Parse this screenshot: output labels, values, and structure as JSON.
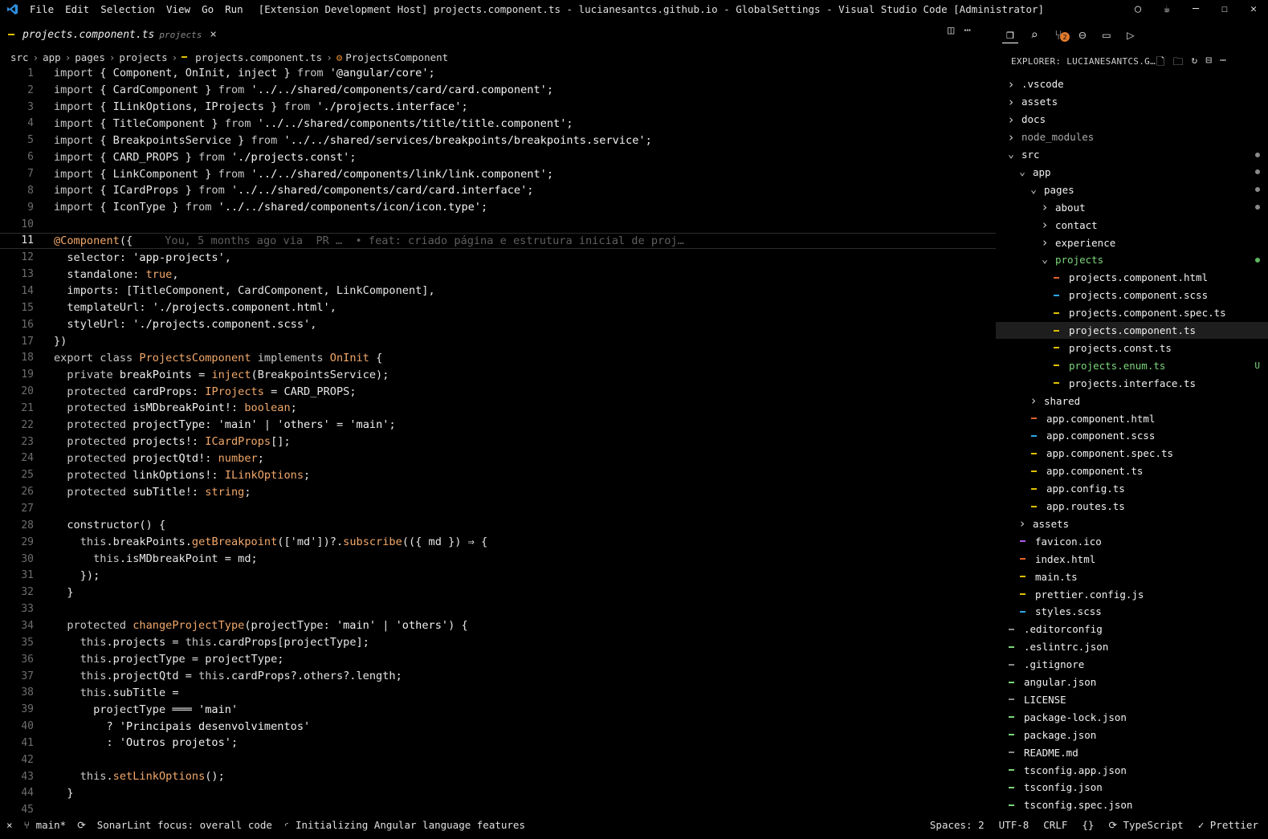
{
  "window": {
    "menu": [
      "File",
      "Edit",
      "Selection",
      "View",
      "Go",
      "Run"
    ],
    "title": "[Extension Development Host] projects.component.ts - lucianesantcs.github.io - GlobalSettings - Visual Studio Code [Administrator]"
  },
  "tab": {
    "name": "projects.component.ts",
    "dir": "projects",
    "close": "×"
  },
  "breadcrumb": {
    "items": [
      "src",
      "app",
      "pages",
      "projects"
    ],
    "file": "projects.component.ts",
    "symbol": "ProjectsComponent"
  },
  "editor": {
    "current_line": 11,
    "blame": "You, 5 months ago via  PR …  • feat: criado página e estrutura inicial de proj…",
    "lines": [
      {
        "n": "1",
        "t": [
          [
            "k",
            "import "
          ],
          [
            "p",
            "{ Component, OnInit, inject } "
          ],
          [
            "k",
            "from "
          ],
          [
            "s",
            "'@angular/core'"
          ],
          [
            "p",
            ";"
          ]
        ]
      },
      {
        "n": "2",
        "t": [
          [
            "k",
            "import "
          ],
          [
            "p",
            "{ CardComponent } "
          ],
          [
            "k",
            "from "
          ],
          [
            "s",
            "'../../shared/components/card/card.component'"
          ],
          [
            "p",
            ";"
          ]
        ]
      },
      {
        "n": "3",
        "t": [
          [
            "k",
            "import "
          ],
          [
            "p",
            "{ ILinkOptions, IProjects } "
          ],
          [
            "k",
            "from "
          ],
          [
            "s",
            "'./projects.interface'"
          ],
          [
            "p",
            ";"
          ]
        ]
      },
      {
        "n": "4",
        "t": [
          [
            "k",
            "import "
          ],
          [
            "p",
            "{ TitleComponent } "
          ],
          [
            "k",
            "from "
          ],
          [
            "s",
            "'../../shared/components/title/title.component'"
          ],
          [
            "p",
            ";"
          ]
        ]
      },
      {
        "n": "5",
        "t": [
          [
            "k",
            "import "
          ],
          [
            "p",
            "{ BreakpointsService } "
          ],
          [
            "k",
            "from "
          ],
          [
            "s",
            "'../../shared/services/breakpoints/breakpoints.service'"
          ],
          [
            "p",
            ";"
          ]
        ]
      },
      {
        "n": "6",
        "t": [
          [
            "k",
            "import "
          ],
          [
            "p",
            "{ CARD_PROPS } "
          ],
          [
            "k",
            "from "
          ],
          [
            "s",
            "'./projects.const'"
          ],
          [
            "p",
            ";"
          ]
        ]
      },
      {
        "n": "7",
        "t": [
          [
            "k",
            "import "
          ],
          [
            "p",
            "{ LinkComponent } "
          ],
          [
            "k",
            "from "
          ],
          [
            "s",
            "'../../shared/components/link/link.component'"
          ],
          [
            "p",
            ";"
          ]
        ]
      },
      {
        "n": "8",
        "t": [
          [
            "k",
            "import "
          ],
          [
            "p",
            "{ ICardProps } "
          ],
          [
            "k",
            "from "
          ],
          [
            "s",
            "'../../shared/components/card/card.interface'"
          ],
          [
            "p",
            ";"
          ]
        ]
      },
      {
        "n": "9",
        "t": [
          [
            "k",
            "import "
          ],
          [
            "p",
            "{ IconType } "
          ],
          [
            "k",
            "from "
          ],
          [
            "s",
            "'../../shared/components/icon/icon.type'"
          ],
          [
            "p",
            ";"
          ]
        ]
      },
      {
        "n": "10",
        "t": []
      },
      {
        "n": "11",
        "t": [
          [
            "d",
            "@Component"
          ],
          [
            "p",
            "({"
          ]
        ]
      },
      {
        "n": "12",
        "t": [
          [
            "p",
            "  selector: "
          ],
          [
            "s",
            "'app-projects'"
          ],
          [
            "p",
            ","
          ]
        ]
      },
      {
        "n": "13",
        "t": [
          [
            "p",
            "  standalone: "
          ],
          [
            "b",
            "true"
          ],
          [
            "p",
            ","
          ]
        ]
      },
      {
        "n": "14",
        "t": [
          [
            "p",
            "  imports: [TitleComponent, CardComponent, LinkComponent],"
          ]
        ]
      },
      {
        "n": "15",
        "t": [
          [
            "p",
            "  templateUrl: "
          ],
          [
            "s",
            "'./projects.component.html'"
          ],
          [
            "p",
            ","
          ]
        ]
      },
      {
        "n": "16",
        "t": [
          [
            "p",
            "  styleUrl: "
          ],
          [
            "s",
            "'./projects.component.scss'"
          ],
          [
            "p",
            ","
          ]
        ]
      },
      {
        "n": "17",
        "t": [
          [
            "p",
            "})"
          ]
        ]
      },
      {
        "n": "18",
        "t": [
          [
            "k",
            "export class "
          ],
          [
            "t",
            "ProjectsComponent "
          ],
          [
            "k",
            "implements "
          ],
          [
            "t",
            "OnInit "
          ],
          [
            "p",
            "{"
          ]
        ]
      },
      {
        "n": "19",
        "t": [
          [
            "k",
            "  private "
          ],
          [
            "v",
            "breakPoints "
          ],
          [
            "p",
            "= "
          ],
          [
            "f",
            "inject"
          ],
          [
            "p",
            "(BreakpointsService);"
          ]
        ]
      },
      {
        "n": "20",
        "t": [
          [
            "k",
            "  protected "
          ],
          [
            "v",
            "cardProps"
          ],
          [
            "p",
            ": "
          ],
          [
            "t",
            "IProjects "
          ],
          [
            "p",
            "= CARD_PROPS;"
          ]
        ]
      },
      {
        "n": "21",
        "t": [
          [
            "k",
            "  protected "
          ],
          [
            "v",
            "isMDbreakPoint"
          ],
          [
            "p",
            "!: "
          ],
          [
            "t",
            "boolean"
          ],
          [
            "p",
            ";"
          ]
        ]
      },
      {
        "n": "22",
        "t": [
          [
            "k",
            "  protected "
          ],
          [
            "v",
            "projectType"
          ],
          [
            "p",
            ": "
          ],
          [
            "s",
            "'main'"
          ],
          [
            "p",
            " | "
          ],
          [
            "s",
            "'others'"
          ],
          [
            "p",
            " = "
          ],
          [
            "s",
            "'main'"
          ],
          [
            "p",
            ";"
          ]
        ]
      },
      {
        "n": "23",
        "t": [
          [
            "k",
            "  protected "
          ],
          [
            "v",
            "projects"
          ],
          [
            "p",
            "!: "
          ],
          [
            "t",
            "ICardProps"
          ],
          [
            "p",
            "[];"
          ]
        ]
      },
      {
        "n": "24",
        "t": [
          [
            "k",
            "  protected "
          ],
          [
            "v",
            "projectQtd"
          ],
          [
            "p",
            "!: "
          ],
          [
            "t",
            "number"
          ],
          [
            "p",
            ";"
          ]
        ]
      },
      {
        "n": "25",
        "t": [
          [
            "k",
            "  protected "
          ],
          [
            "v",
            "linkOptions"
          ],
          [
            "p",
            "!: "
          ],
          [
            "t",
            "ILinkOptions"
          ],
          [
            "p",
            ";"
          ]
        ]
      },
      {
        "n": "26",
        "t": [
          [
            "k",
            "  protected "
          ],
          [
            "v",
            "subTitle"
          ],
          [
            "p",
            "!: "
          ],
          [
            "t",
            "string"
          ],
          [
            "p",
            ";"
          ]
        ]
      },
      {
        "n": "27",
        "t": []
      },
      {
        "n": "28",
        "t": [
          [
            "p",
            "  constructor() {"
          ]
        ]
      },
      {
        "n": "29",
        "t": [
          [
            "k",
            "    this"
          ],
          [
            "p",
            ".breakPoints."
          ],
          [
            "f",
            "getBreakpoint"
          ],
          [
            "p",
            "(['md'])?."
          ],
          [
            "f",
            "subscribe"
          ],
          [
            "p",
            "(({ md }) ⇒ {"
          ]
        ]
      },
      {
        "n": "30",
        "t": [
          [
            "k",
            "      this"
          ],
          [
            "p",
            ".isMDbreakPoint = md;"
          ]
        ]
      },
      {
        "n": "31",
        "t": [
          [
            "p",
            "    });"
          ]
        ]
      },
      {
        "n": "32",
        "t": [
          [
            "p",
            "  }"
          ]
        ]
      },
      {
        "n": "33",
        "t": []
      },
      {
        "n": "34",
        "t": [
          [
            "k",
            "  protected "
          ],
          [
            "f",
            "changeProjectType"
          ],
          [
            "p",
            "(projectType: "
          ],
          [
            "s",
            "'main'"
          ],
          [
            "p",
            " | "
          ],
          [
            "s",
            "'others'"
          ],
          [
            "p",
            ") {"
          ]
        ]
      },
      {
        "n": "35",
        "t": [
          [
            "k",
            "    this"
          ],
          [
            "p",
            ".projects = "
          ],
          [
            "k",
            "this"
          ],
          [
            "p",
            ".cardProps[projectType];"
          ]
        ]
      },
      {
        "n": "36",
        "t": [
          [
            "k",
            "    this"
          ],
          [
            "p",
            ".projectType = projectType;"
          ]
        ]
      },
      {
        "n": "37",
        "t": [
          [
            "k",
            "    this"
          ],
          [
            "p",
            ".projectQtd = "
          ],
          [
            "k",
            "this"
          ],
          [
            "p",
            ".cardProps?.others?.length;"
          ]
        ]
      },
      {
        "n": "38",
        "t": [
          [
            "k",
            "    this"
          ],
          [
            "p",
            ".subTitle ="
          ]
        ]
      },
      {
        "n": "39",
        "t": [
          [
            "p",
            "      projectType ═══ "
          ],
          [
            "s",
            "'main'"
          ]
        ]
      },
      {
        "n": "40",
        "t": [
          [
            "p",
            "        ? "
          ],
          [
            "s",
            "'Principais desenvolvimentos'"
          ]
        ]
      },
      {
        "n": "41",
        "t": [
          [
            "p",
            "        : "
          ],
          [
            "s",
            "'Outros projetos'"
          ],
          [
            "p",
            ";"
          ]
        ]
      },
      {
        "n": "42",
        "t": []
      },
      {
        "n": "43",
        "t": [
          [
            "k",
            "    this"
          ],
          [
            "p",
            "."
          ],
          [
            "f",
            "setLinkOptions"
          ],
          [
            "p",
            "();"
          ]
        ]
      },
      {
        "n": "44",
        "t": [
          [
            "p",
            "  }"
          ]
        ]
      },
      {
        "n": "45",
        "t": []
      }
    ]
  },
  "explorer": {
    "header": "EXPLORER: LUCIANESANTCS.G…",
    "items": [
      {
        "label": ".vscode",
        "depth": 0,
        "kind": "folder"
      },
      {
        "label": "assets",
        "depth": 0,
        "kind": "folder"
      },
      {
        "label": "docs",
        "depth": 0,
        "kind": "folder"
      },
      {
        "label": "node_modules",
        "depth": 0,
        "kind": "folder",
        "dim": true
      },
      {
        "label": "src",
        "depth": 0,
        "kind": "folder-open",
        "dot": "grey"
      },
      {
        "label": "app",
        "depth": 1,
        "kind": "folder-open",
        "dot": "grey"
      },
      {
        "label": "pages",
        "depth": 2,
        "kind": "folder-open",
        "dot": "grey"
      },
      {
        "label": "about",
        "depth": 3,
        "kind": "folder",
        "dot": "grey"
      },
      {
        "label": "contact",
        "depth": 3,
        "kind": "folder"
      },
      {
        "label": "experience",
        "depth": 3,
        "kind": "folder"
      },
      {
        "label": "projects",
        "depth": 3,
        "kind": "folder-open",
        "dot": "green",
        "green": true
      },
      {
        "label": "projects.component.html",
        "depth": 4,
        "kind": "file",
        "color": "#e8622c"
      },
      {
        "label": "projects.component.scss",
        "depth": 4,
        "kind": "file",
        "color": "#2ca8e8"
      },
      {
        "label": "projects.component.spec.ts",
        "depth": 4,
        "kind": "file",
        "color": "#e0c000"
      },
      {
        "label": "projects.component.ts",
        "depth": 4,
        "kind": "file",
        "color": "#e0c000",
        "selected": true
      },
      {
        "label": "projects.const.ts",
        "depth": 4,
        "kind": "file",
        "color": "#e0c000"
      },
      {
        "label": "projects.enum.ts",
        "depth": 4,
        "kind": "file",
        "color": "#e0c000",
        "green": true,
        "u": "U"
      },
      {
        "label": "projects.interface.ts",
        "depth": 4,
        "kind": "file",
        "color": "#e0c000"
      },
      {
        "label": "shared",
        "depth": 2,
        "kind": "folder"
      },
      {
        "label": "app.component.html",
        "depth": 2,
        "kind": "file",
        "color": "#e8622c"
      },
      {
        "label": "app.component.scss",
        "depth": 2,
        "kind": "file",
        "color": "#2ca8e8"
      },
      {
        "label": "app.component.spec.ts",
        "depth": 2,
        "kind": "file",
        "color": "#e0c000"
      },
      {
        "label": "app.component.ts",
        "depth": 2,
        "kind": "file",
        "color": "#e0c000"
      },
      {
        "label": "app.config.ts",
        "depth": 2,
        "kind": "file",
        "color": "#e0c000"
      },
      {
        "label": "app.routes.ts",
        "depth": 2,
        "kind": "file",
        "color": "#e0c000"
      },
      {
        "label": "assets",
        "depth": 1,
        "kind": "folder"
      },
      {
        "label": "favicon.ico",
        "depth": 1,
        "kind": "file",
        "color": "#b05ce8"
      },
      {
        "label": "index.html",
        "depth": 1,
        "kind": "file",
        "color": "#e8622c"
      },
      {
        "label": "main.ts",
        "depth": 1,
        "kind": "file",
        "color": "#e0c000"
      },
      {
        "label": "prettier.config.js",
        "depth": 1,
        "kind": "file",
        "color": "#e0c000"
      },
      {
        "label": "styles.scss",
        "depth": 1,
        "kind": "file",
        "color": "#2ca8e8"
      },
      {
        "label": ".editorconfig",
        "depth": 0,
        "kind": "file",
        "color": "#8a8a8a"
      },
      {
        "label": ".eslintrc.json",
        "depth": 0,
        "kind": "file",
        "color": "#7cd67c"
      },
      {
        "label": ".gitignore",
        "depth": 0,
        "kind": "file",
        "color": "#8a8a8a"
      },
      {
        "label": "angular.json",
        "depth": 0,
        "kind": "file",
        "color": "#7cd67c"
      },
      {
        "label": "LICENSE",
        "depth": 0,
        "kind": "file",
        "color": "#8a8a8a"
      },
      {
        "label": "package-lock.json",
        "depth": 0,
        "kind": "file",
        "color": "#7cd67c"
      },
      {
        "label": "package.json",
        "depth": 0,
        "kind": "file",
        "color": "#7cd67c"
      },
      {
        "label": "README.md",
        "depth": 0,
        "kind": "file",
        "color": "#8a8a8a"
      },
      {
        "label": "tsconfig.app.json",
        "depth": 0,
        "kind": "file",
        "color": "#7cd67c"
      },
      {
        "label": "tsconfig.json",
        "depth": 0,
        "kind": "file",
        "color": "#7cd67c"
      },
      {
        "label": "tsconfig.spec.json",
        "depth": 0,
        "kind": "file",
        "color": "#7cd67c"
      }
    ]
  },
  "sidebar_badge": "2",
  "statusbar": {
    "branch": "main*",
    "sonarlint": "SonarLint focus: overall code",
    "angular": "Initializing Angular language features",
    "spaces": "Spaces: 2",
    "encoding": "UTF-8",
    "eol": "CRLF",
    "braces": "{}",
    "language": "TypeScript",
    "prettier": "Prettier"
  },
  "colors": {
    "ts_marker": "#e0c000",
    "html_marker": "#e8622c",
    "scss_marker": "#2ca8e8",
    "git_added": "#7cd67c"
  }
}
